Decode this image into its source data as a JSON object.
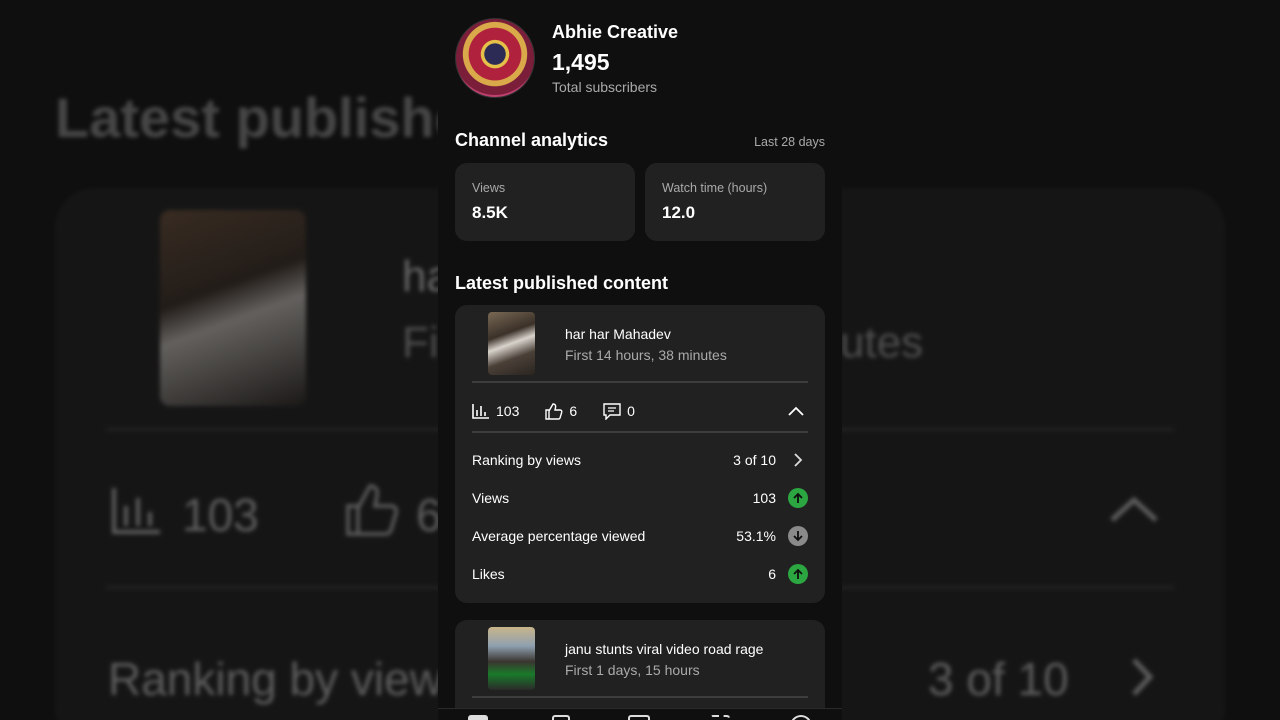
{
  "channel": {
    "name": "Abhie Creative",
    "subscribers": "1,495",
    "subscribers_label": "Total subscribers"
  },
  "analytics": {
    "title": "Channel analytics",
    "period": "Last 28 days",
    "views_label": "Views",
    "views_value": "8.5K",
    "watch_label": "Watch time (hours)",
    "watch_value": "12.0"
  },
  "latest": {
    "title": "Latest published content",
    "items": [
      {
        "title": "har har Mahadev",
        "subtitle": "First 14 hours, 38 minutes",
        "views": "103",
        "likes": "6",
        "comments": "0",
        "metrics": [
          {
            "label": "Ranking by views",
            "value": "3 of 10",
            "indicator": "chevron-right"
          },
          {
            "label": "Views",
            "value": "103",
            "indicator": "up"
          },
          {
            "label": "Average percentage viewed",
            "value": "53.1%",
            "indicator": "down"
          },
          {
            "label": "Likes",
            "value": "6",
            "indicator": "up"
          }
        ]
      },
      {
        "title": "janu stunts viral video road rage",
        "subtitle": "First 1 days, 15 hours"
      }
    ]
  },
  "background": {
    "title": "Latest publishe",
    "text1": "ha",
    "text2": "Fi",
    "text3": "utes",
    "stat1": "103",
    "stat2": "6",
    "rank": "Ranking by views",
    "rank_value": "3 of 10"
  },
  "colors": {
    "up": "#2ba640",
    "down": "#8a8a8a",
    "card": "#212121",
    "background": "#0f0f0f"
  }
}
